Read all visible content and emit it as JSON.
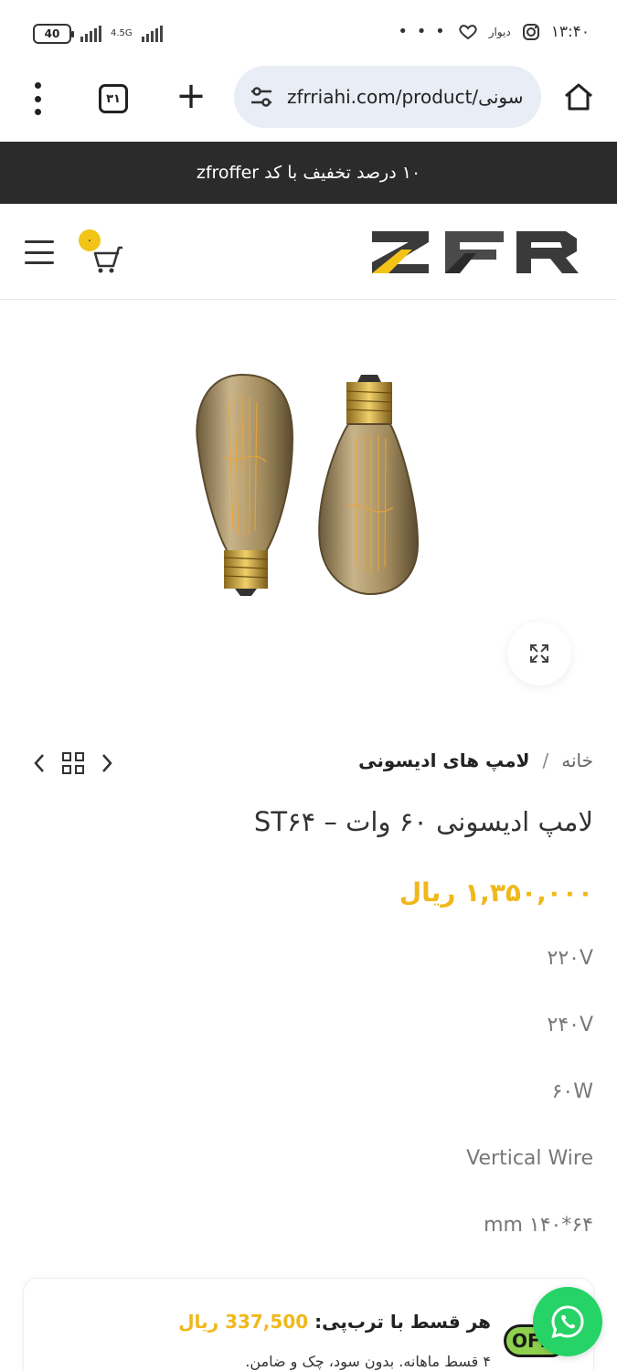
{
  "status_bar": {
    "battery": "40",
    "network": "4.5G",
    "time": "۱۳:۴۰",
    "app_label": "دیوار",
    "more": "• • •"
  },
  "browser": {
    "url": "zfrriahi.com/product/سونی",
    "tab_count": "۳۱",
    "plus": "+"
  },
  "banner": {
    "text": "۱۰ درصد تخفیف با کد zfroffer"
  },
  "header": {
    "cart_count": "۰",
    "logo_text": "ZFR",
    "brand_yellow": "#f2c418"
  },
  "breadcrumb": {
    "home": "خانه",
    "separator": "/",
    "category": "لامپ های ادیسونی"
  },
  "product": {
    "title": "لامپ ادیسونی ۶۰ وات – ST۶۴",
    "price": "۱,۳۵۰,۰۰۰ ریال",
    "specs": [
      "۲۲۰V",
      "۲۴۰V",
      "۶۰W",
      "Vertical Wire",
      "mm ۱۴۰*۶۴"
    ]
  },
  "installment": {
    "label": "هر قسط با ترب‌پی:",
    "amount": "337,500 ریال",
    "subtext": "۴ قسط ماهانه. بدون سود، چک و ضامن.",
    "badge": "OFF"
  }
}
